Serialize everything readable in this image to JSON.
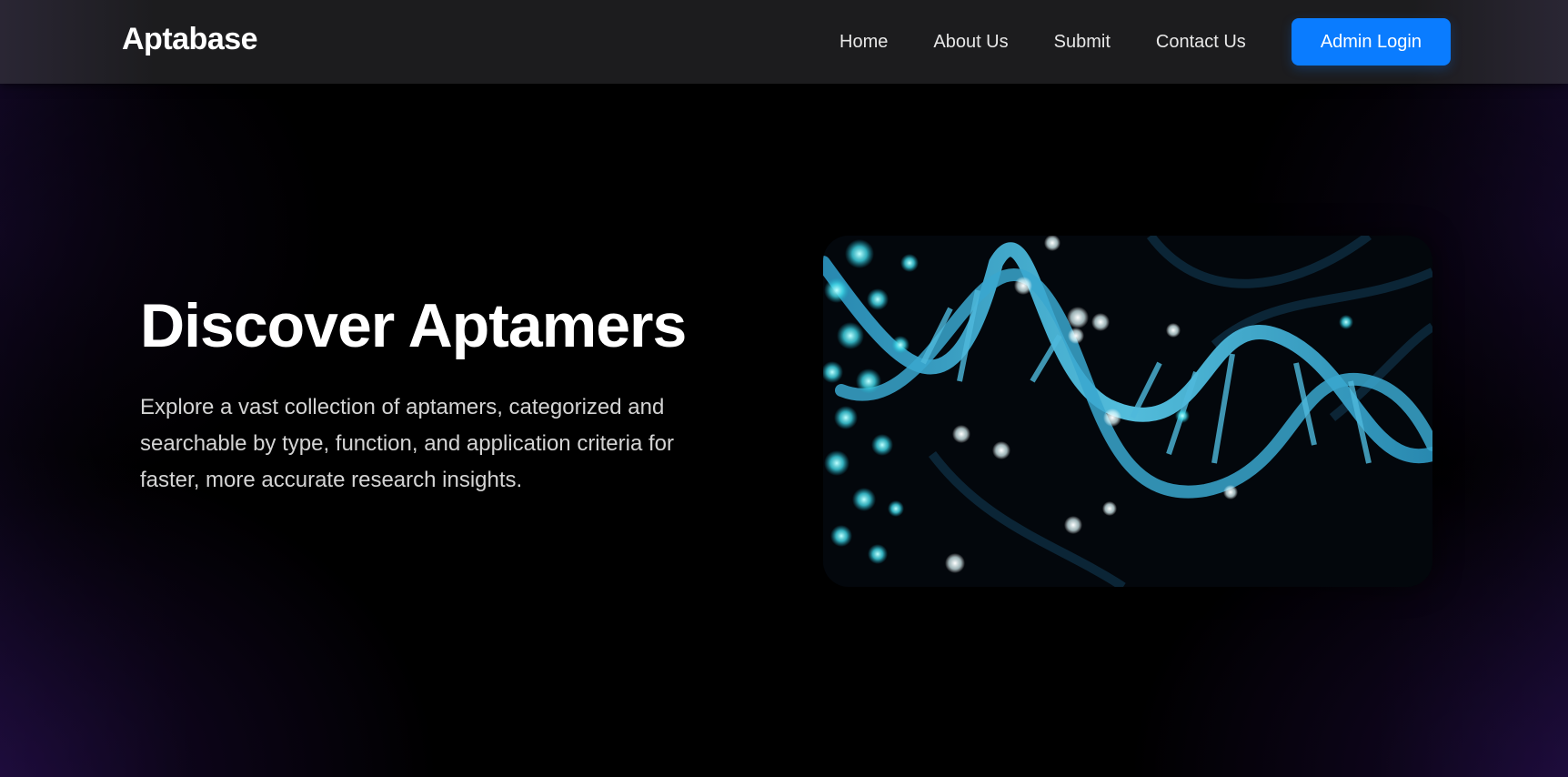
{
  "header": {
    "brand": "Aptabase",
    "nav": [
      {
        "label": "Home"
      },
      {
        "label": "About Us"
      },
      {
        "label": "Submit"
      },
      {
        "label": "Contact Us"
      }
    ],
    "login_label": "Admin Login"
  },
  "hero": {
    "title": "Discover Aptamers",
    "description": "Explore a vast collection of aptamers, categorized and searchable by type, function, and application criteria for faster, more accurate research insights.",
    "image_icon": "dna-helix-image"
  },
  "colors": {
    "accent": "#0a7cff",
    "background": "#000000",
    "navbar": "#1c1c1e"
  }
}
